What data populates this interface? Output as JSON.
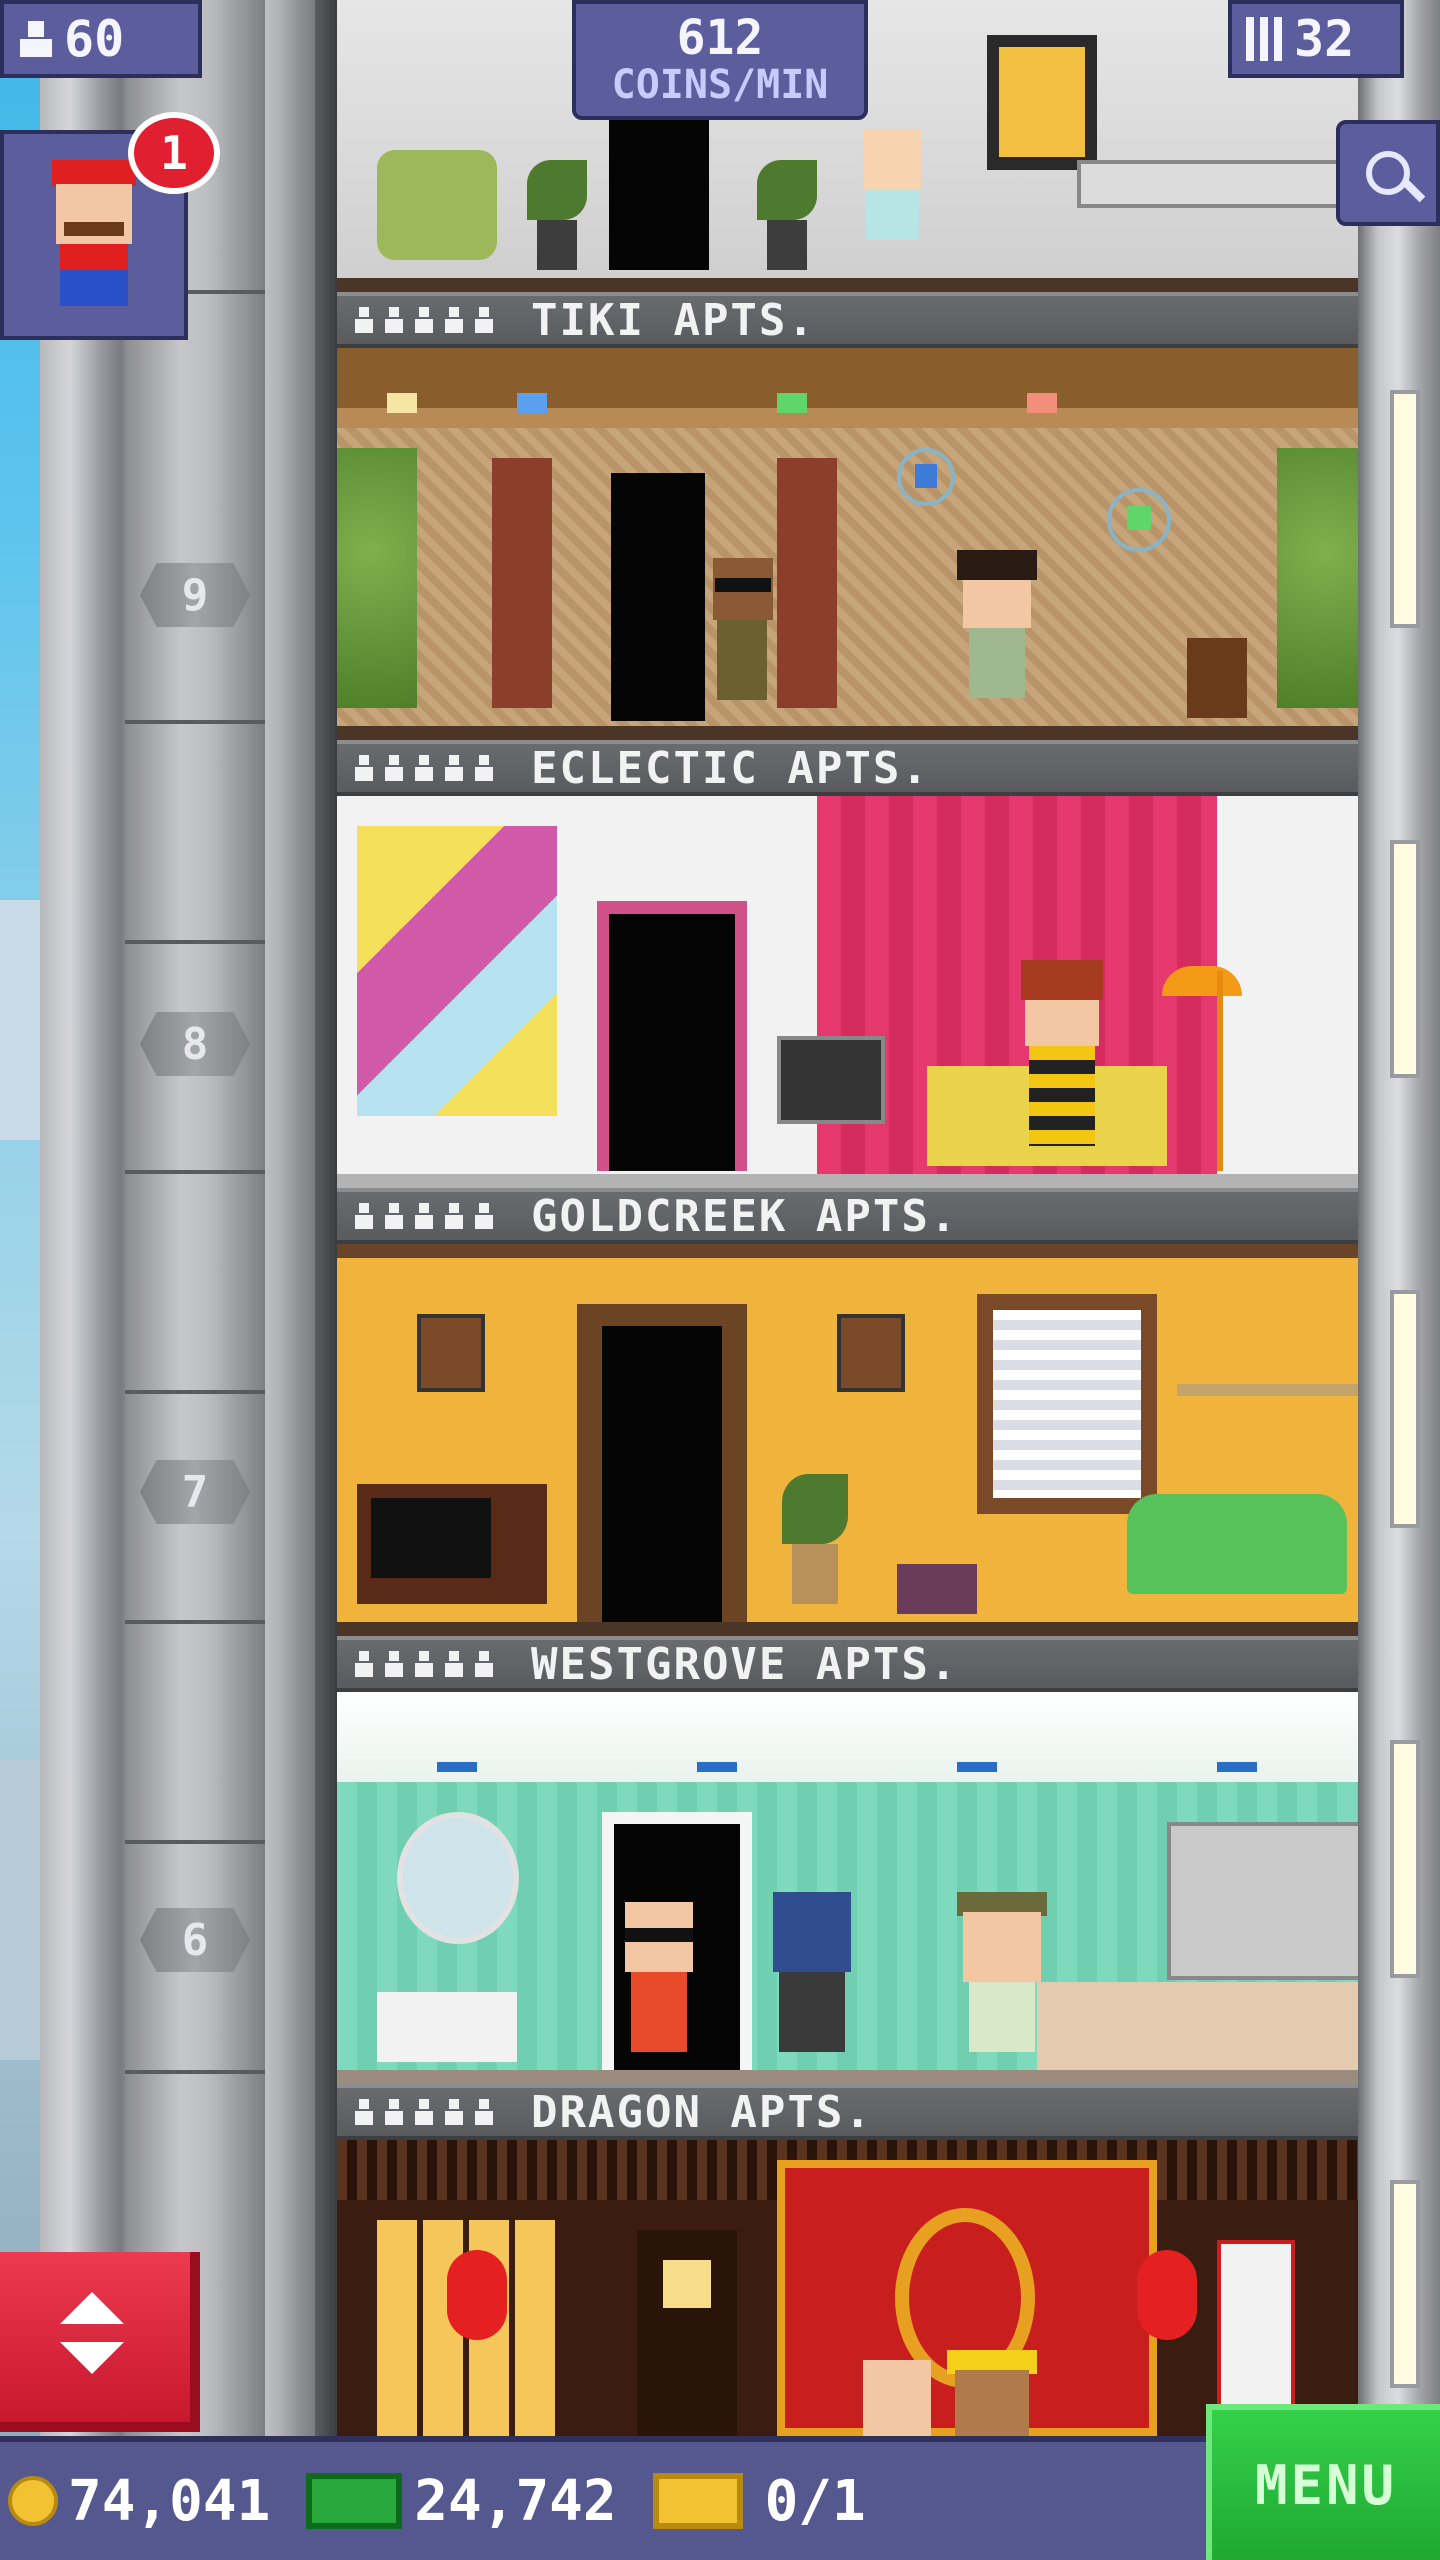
{
  "hud": {
    "population": "60",
    "coins_per_min_value": "612",
    "coins_per_min_label": "COINS/MIN",
    "floors_count": "32",
    "notification_count": "1"
  },
  "floors": [
    {
      "label": "TIKI APTS.",
      "number": "9"
    },
    {
      "label": "ECLECTIC APTS.",
      "number": "8"
    },
    {
      "label": "GOLDCREEK APTS.",
      "number": "7"
    },
    {
      "label": "WESTGROVE APTS.",
      "number": "6"
    },
    {
      "label": "DRAGON APTS.",
      "number": ""
    }
  ],
  "bottom_bar": {
    "coins": "74,041",
    "bux": "24,742",
    "vip": "0/1",
    "menu_label": "MENU"
  },
  "colors": {
    "hud_bg": "#5b5d9c",
    "menu_green": "#2fc043",
    "elevator_red": "#e22b44",
    "badge_red": "#e02030"
  }
}
